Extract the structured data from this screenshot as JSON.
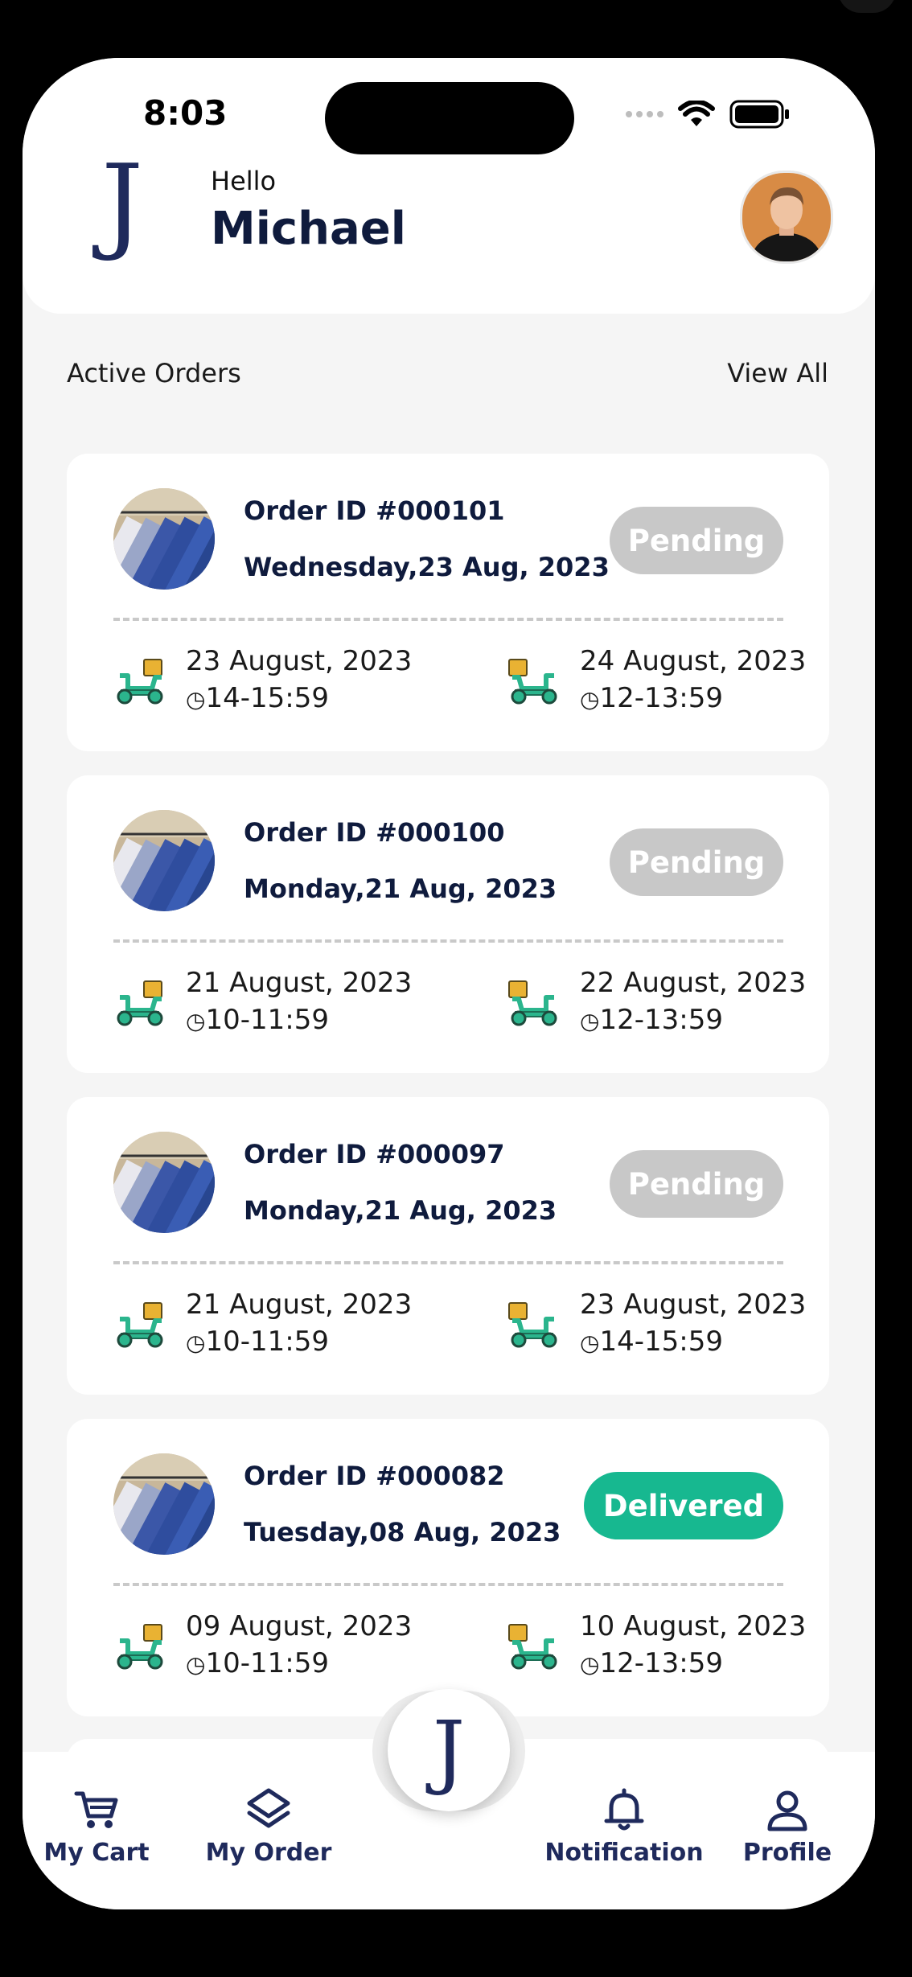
{
  "status_bar": {
    "time": "8:03"
  },
  "header": {
    "greeting": "Hello",
    "user_name": "Michael",
    "logo_letter": "J"
  },
  "active_orders": {
    "title": "Active Orders",
    "view_all": "View All"
  },
  "orders": [
    {
      "id": "Order ID #000101",
      "date": "Wednesday,23 Aug, 2023",
      "status": "Pending",
      "pickup_date": "23 August, 2023",
      "pickup_time": "14-15:59",
      "delivery_date": "24 August, 2023",
      "delivery_time": "12-13:59"
    },
    {
      "id": "Order ID #000100",
      "date": "Monday,21 Aug, 2023",
      "status": "Pending",
      "pickup_date": "21 August, 2023",
      "pickup_time": "10-11:59",
      "delivery_date": "22 August, 2023",
      "delivery_time": "12-13:59"
    },
    {
      "id": "Order ID #000097",
      "date": "Monday,21 Aug, 2023",
      "status": "Pending",
      "pickup_date": "21 August, 2023",
      "pickup_time": "10-11:59",
      "delivery_date": "23 August, 2023",
      "delivery_time": "14-15:59"
    },
    {
      "id": "Order ID #000082",
      "date": "Tuesday,08 Aug, 2023",
      "status": "Delivered",
      "pickup_date": "09 August, 2023",
      "pickup_time": "10-11:59",
      "delivery_date": "10 August, 2023",
      "delivery_time": "12-13:59"
    }
  ],
  "tabbar": {
    "my_cart": "My Cart",
    "my_order": "My Order",
    "center_letter": "J",
    "notification": "Notification",
    "profile": "Profile"
  },
  "colors": {
    "brand_navy": "#1f2a5c",
    "pending": "#c8c8c8",
    "delivered": "#17b890",
    "scooter": "#2bb58d"
  }
}
